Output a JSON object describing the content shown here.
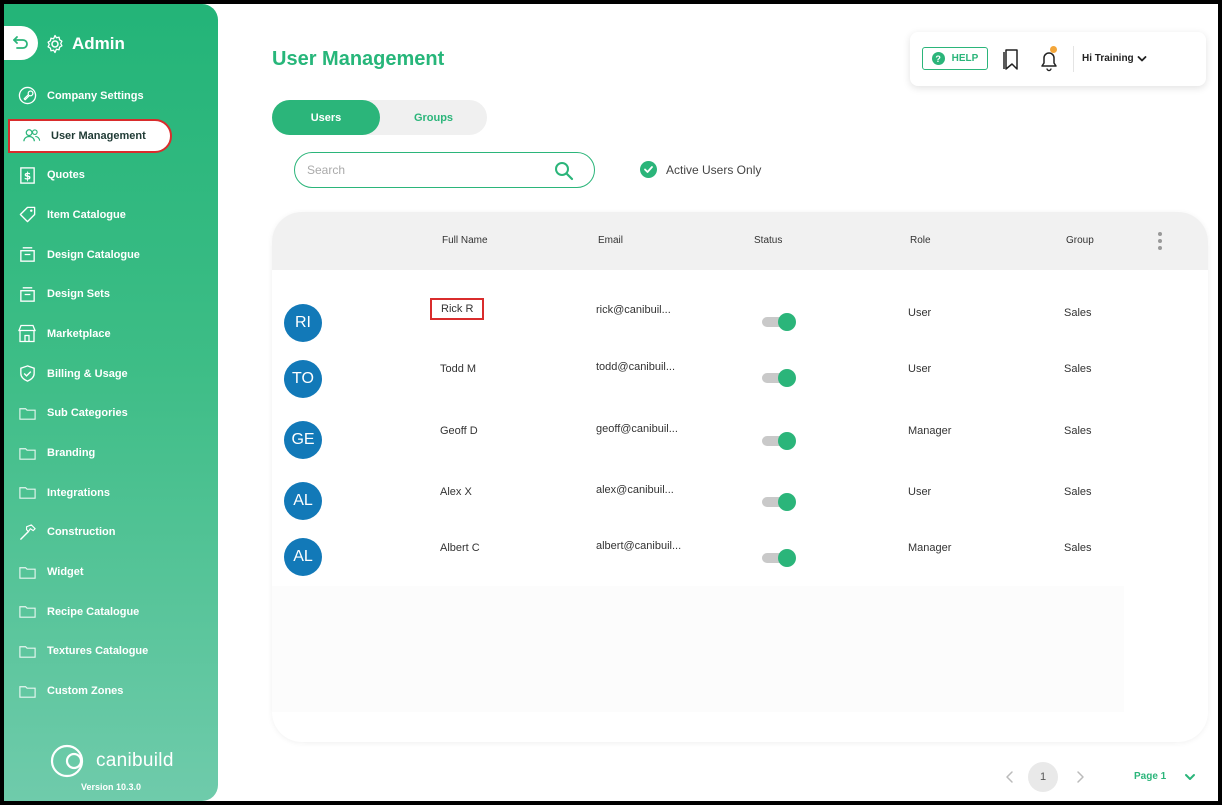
{
  "sidebar": {
    "title": "Admin",
    "items": [
      {
        "label": "Company Settings",
        "icon": "wrench-circle-icon"
      },
      {
        "label": "User Management",
        "icon": "users-icon",
        "active": true
      },
      {
        "label": "Quotes",
        "icon": "dollar-doc-icon"
      },
      {
        "label": "Item Catalogue",
        "icon": "tag-icon"
      },
      {
        "label": "Design Catalogue",
        "icon": "tray-icon"
      },
      {
        "label": "Design Sets",
        "icon": "tray-icon"
      },
      {
        "label": "Marketplace",
        "icon": "storefront-icon"
      },
      {
        "label": "Billing & Usage",
        "icon": "shield-check-icon"
      },
      {
        "label": "Sub Categories",
        "icon": "folder-icon"
      },
      {
        "label": "Branding",
        "icon": "folder-icon"
      },
      {
        "label": "Integrations",
        "icon": "folder-icon"
      },
      {
        "label": "Construction",
        "icon": "hammer-icon"
      },
      {
        "label": "Widget",
        "icon": "folder-icon"
      },
      {
        "label": "Recipe Catalogue",
        "icon": "folder-icon"
      },
      {
        "label": "Textures Catalogue",
        "icon": "folder-icon"
      },
      {
        "label": "Custom Zones",
        "icon": "folder-icon"
      }
    ],
    "logo_text": "canibuild",
    "version": "Version 10.3.0"
  },
  "header": {
    "title": "User Management",
    "help_label": "HELP",
    "greeting": "Hi Training"
  },
  "tabs": [
    {
      "label": "Users",
      "active": true
    },
    {
      "label": "Groups",
      "active": false
    }
  ],
  "search": {
    "placeholder": "Search",
    "value": ""
  },
  "filter": {
    "active_only_label": "Active Users Only",
    "checked": true
  },
  "table": {
    "columns": [
      "Full Name",
      "Email",
      "Status",
      "Role",
      "Group"
    ],
    "rows": [
      {
        "initials": "RI",
        "name": "Rick R",
        "email": "rick@canibuil...",
        "active": true,
        "role": "User",
        "group": "Sales"
      },
      {
        "initials": "TO",
        "name": "Todd M",
        "email": "todd@canibuil...",
        "active": true,
        "role": "User",
        "group": "Sales"
      },
      {
        "initials": "GE",
        "name": "Geoff D",
        "email": "geoff@canibuil...",
        "active": true,
        "role": "Manager",
        "group": "Sales"
      },
      {
        "initials": "AL",
        "name": "Alex X",
        "email": "alex@canibuil...",
        "active": true,
        "role": "User",
        "group": "Sales"
      },
      {
        "initials": "AL",
        "name": "Albert C",
        "email": "albert@canibuil...",
        "active": true,
        "role": "Manager",
        "group": "Sales"
      }
    ]
  },
  "pagination": {
    "current": "1",
    "label": "Page 1"
  },
  "colors": {
    "accent": "#2bb57a",
    "avatar": "#1279b8",
    "highlight": "#d92c2c"
  }
}
